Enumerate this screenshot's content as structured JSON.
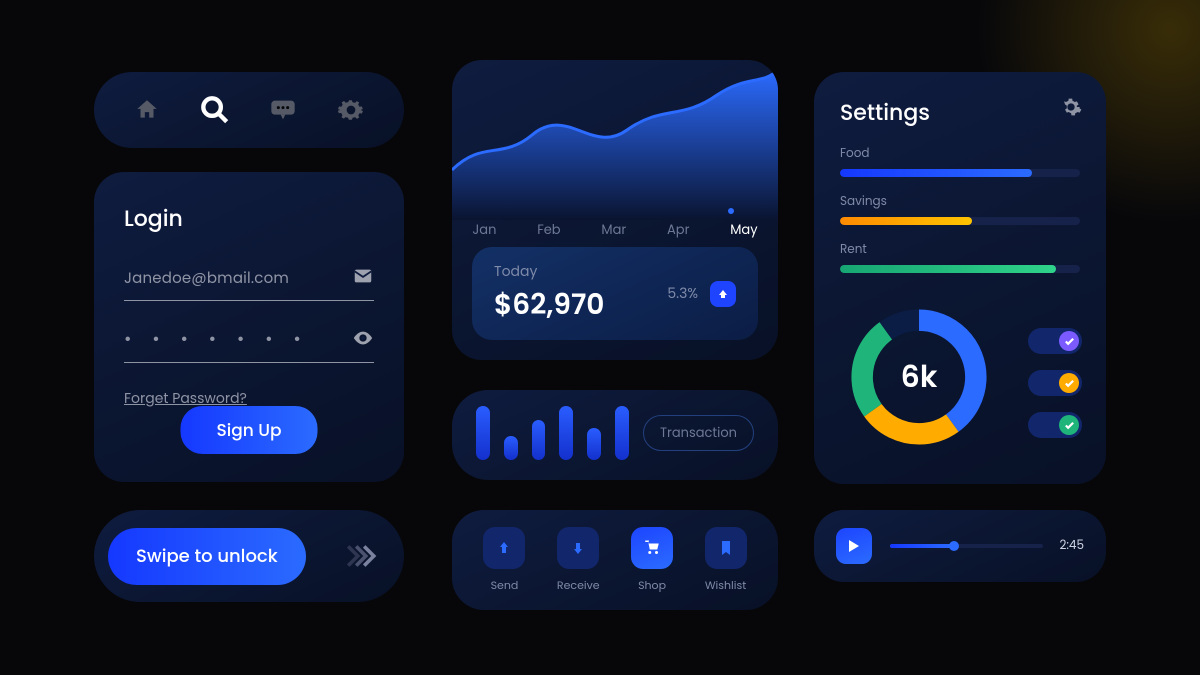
{
  "nav": {
    "icons": [
      "home",
      "search",
      "chat",
      "settings"
    ],
    "active": 1
  },
  "login": {
    "title": "Login",
    "email": "Janedoe@bmail.com",
    "password_masked": "• • • • • • •",
    "forgot": "Forget Password?",
    "signup": "Sign Up"
  },
  "swipe": {
    "label": "Swipe to unlock"
  },
  "chart_data": {
    "type": "area",
    "categories": [
      "Jan",
      "Feb",
      "Mar",
      "Apr",
      "May"
    ],
    "active_category": "May",
    "values": [
      38,
      52,
      48,
      70,
      92
    ],
    "ylim": [
      0,
      100
    ],
    "today_label": "Today",
    "today_value": "$62,970",
    "change_pct": "5.3%",
    "change_dir": "up"
  },
  "equalizer": {
    "bars": [
      54,
      24,
      40,
      54,
      32,
      54
    ],
    "button": "Transaction"
  },
  "actions": [
    {
      "icon": "arrow-up",
      "label": "Send"
    },
    {
      "icon": "arrow-down",
      "label": "Receive"
    },
    {
      "icon": "cart",
      "label": "Shop",
      "active": true
    },
    {
      "icon": "bookmark",
      "label": "Wishlist"
    }
  ],
  "settings": {
    "title": "Settings",
    "bars": [
      {
        "label": "Food",
        "pct": 80,
        "gradient": [
          "#1538ff",
          "#2b6bff"
        ]
      },
      {
        "label": "Savings",
        "pct": 55,
        "gradient": [
          "#ff8a00",
          "#ffc400"
        ]
      },
      {
        "label": "Rent",
        "pct": 90,
        "gradient": [
          "#17a673",
          "#2fd38a"
        ]
      }
    ],
    "donut": {
      "center": "6k",
      "segments": [
        {
          "color": "#2b6bff",
          "pct": 40
        },
        {
          "color": "#ffab00",
          "pct": 25
        },
        {
          "color": "#1fb57a",
          "pct": 25
        },
        {
          "color": "#0b1d45",
          "pct": 10
        }
      ]
    },
    "toggles": [
      {
        "color": "#7b5bff"
      },
      {
        "color": "#ffab00"
      },
      {
        "color": "#1fb57a"
      }
    ]
  },
  "player": {
    "progress_pct": 42,
    "time": "2:45"
  }
}
